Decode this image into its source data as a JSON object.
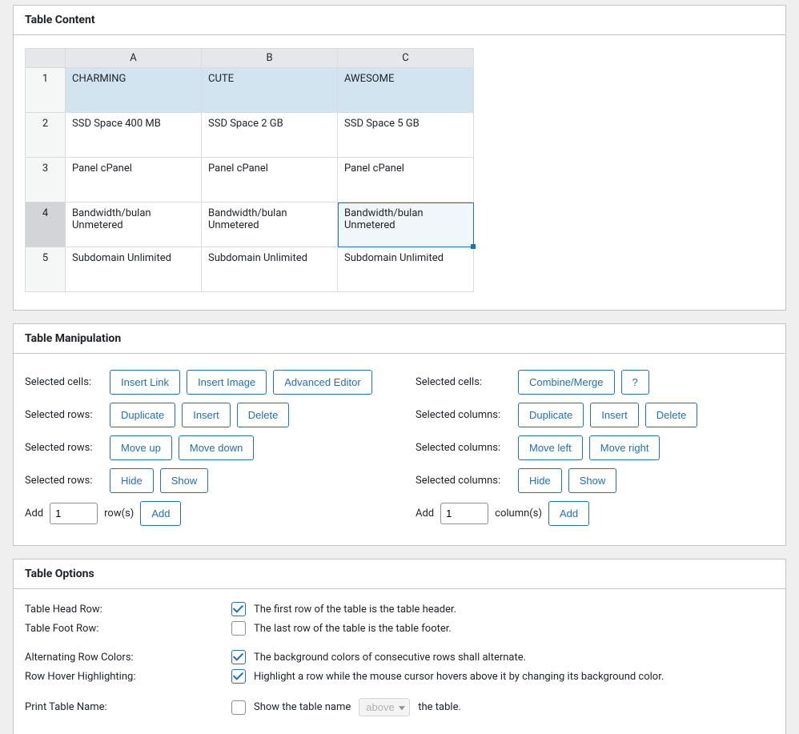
{
  "panels": {
    "content": {
      "title": "Table Content"
    },
    "manip": {
      "title": "Table Manipulation"
    },
    "options": {
      "title": "Table Options"
    }
  },
  "table": {
    "columns": [
      "A",
      "B",
      "C"
    ],
    "rows": [
      {
        "num": "1",
        "cells": [
          "CHARMING",
          "CUTE",
          "AWESOME"
        ]
      },
      {
        "num": "2",
        "cells": [
          "SSD Space 400 MB",
          "SSD Space 2 GB",
          "SSD Space 5 GB"
        ]
      },
      {
        "num": "3",
        "cells": [
          "Panel cPanel",
          "Panel cPanel",
          "Panel cPanel"
        ]
      },
      {
        "num": "4",
        "cells": [
          "Bandwidth/bulan Unmetered",
          "Bandwidth/bulan Unmetered",
          "Bandwidth/bulan Unmetered"
        ]
      },
      {
        "num": "5",
        "cells": [
          "Subdomain Unlimited",
          "Subdomain Unlimited",
          "Subdomain Unlimited"
        ]
      }
    ]
  },
  "manip": {
    "left": {
      "cells_label": "Selected cells:",
      "insert_link": "Insert Link",
      "insert_image": "Insert Image",
      "advanced_editor": "Advanced Editor",
      "rows_label": "Selected rows:",
      "duplicate": "Duplicate",
      "insert": "Insert",
      "delete": "Delete",
      "move_up": "Move up",
      "move_down": "Move down",
      "hide": "Hide",
      "show": "Show",
      "add_prefix": "Add",
      "rows_value": "1",
      "rows_suffix": "row(s)",
      "add_btn": "Add"
    },
    "right": {
      "cells_label": "Selected cells:",
      "combine": "Combine/Merge",
      "help": "?",
      "cols_label": "Selected columns:",
      "duplicate": "Duplicate",
      "insert": "Insert",
      "delete": "Delete",
      "move_left": "Move left",
      "move_right": "Move right",
      "hide": "Hide",
      "show": "Show",
      "add_prefix": "Add",
      "cols_value": "1",
      "cols_suffix": "column(s)",
      "add_btn": "Add"
    }
  },
  "options": {
    "head_row_label": "Table Head Row:",
    "head_row_text": "The first row of the table is the table header.",
    "foot_row_label": "Table Foot Row:",
    "foot_row_text": "The last row of the table is the table footer.",
    "alt_colors_label": "Alternating Row Colors:",
    "alt_colors_text": "The background colors of consecutive rows shall alternate.",
    "hover_label": "Row Hover Highlighting:",
    "hover_text": "Highlight a row while the mouse cursor hovers above it by changing its background color.",
    "print_name_label": "Print Table Name:",
    "print_name_prefix": "Show the table name",
    "print_name_select": "above",
    "print_name_suffix": "the table."
  }
}
